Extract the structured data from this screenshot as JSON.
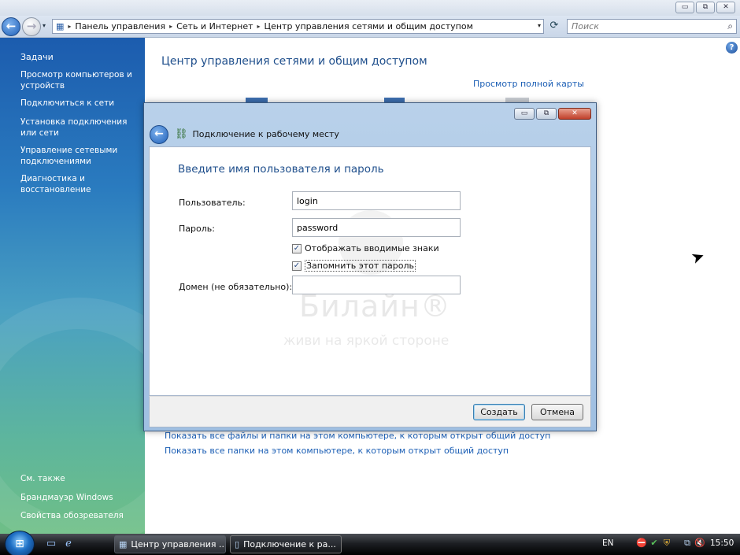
{
  "window": {
    "min_label": "▭",
    "max_label": "⧉",
    "close_label": "✕"
  },
  "address": {
    "back": "←",
    "forward": "→",
    "breadcrumbs": [
      "Панель управления",
      "Сеть и Интернет",
      "Центр управления сетями и общим доступом"
    ],
    "separator": "▸",
    "dropdown": "▾",
    "refresh": "⟳",
    "search_placeholder": "Поиск"
  },
  "sidebar": {
    "title": "Задачи",
    "tasks": [
      "Просмотр компьютеров и устройств",
      "Подключиться к сети",
      "Установка подключения или сети",
      "Управление сетевыми подключениями",
      "Диагностика и восстановление"
    ],
    "see_also_title": "См. также",
    "see_also": [
      "Брандмауэр Windows",
      "Свойства обозревателя"
    ]
  },
  "main": {
    "title": "Центр управления сетями и общим доступом",
    "full_map_link": "Просмотр полной карты",
    "links": [
      "Показать все файлы и папки на этом компьютере, к которым открыт общий доступ",
      "Показать все папки на этом компьютере, к которым открыт общий доступ"
    ],
    "help": "?"
  },
  "dialog": {
    "title": "Подключение к рабочему месту",
    "heading": "Введите имя пользователя и пароль",
    "user_label": "Пользователь:",
    "user_value": "login",
    "password_label": "Пароль:",
    "password_value": "password",
    "show_chars_label": "Отображать вводимые знаки",
    "show_chars_checked": true,
    "remember_label": "Запомнить этот пароль",
    "remember_checked": true,
    "domain_label": "Домен (не обязательно):",
    "domain_value": "",
    "create_button": "Создать",
    "cancel_button": "Отмена",
    "watermark_brand": "Билайн®",
    "watermark_slogan": "живи на яркой стороне"
  },
  "taskbar": {
    "tasks": [
      "Центр управления ...",
      "Подключение к ра..."
    ],
    "language": "EN",
    "clock": "15:50"
  }
}
